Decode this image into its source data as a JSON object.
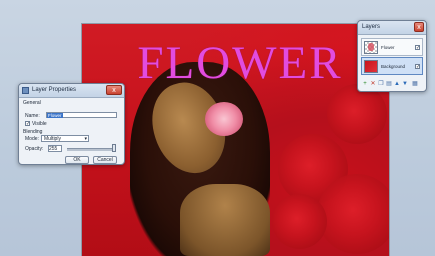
{
  "canvas": {
    "title": "FLOWER"
  },
  "layer_properties": {
    "window_title": "Layer Properties",
    "close_label": "x",
    "general_label": "General",
    "name_label": "Name:",
    "name_value": "Flower",
    "visible_label": "Visible",
    "visible_checked": true,
    "blending_label": "Blending",
    "mode_label": "Mode:",
    "mode_value": "Multiply",
    "opacity_label": "Opacity:",
    "opacity_value": "255",
    "ok_label": "OK",
    "cancel_label": "Cancel"
  },
  "layers_panel": {
    "window_title": "Layers",
    "close_label": "x",
    "layers": [
      {
        "name": "Flower",
        "visible": true,
        "selected": false
      },
      {
        "name": "Background",
        "visible": true,
        "selected": true
      }
    ],
    "tools": [
      "add-layer-icon",
      "delete-layer-icon",
      "duplicate-layer-icon",
      "merge-layer-icon",
      "move-up-icon",
      "move-down-icon",
      "properties-icon"
    ]
  },
  "colors": {
    "accent": "#3a74c9",
    "title_text": "#e24cdf",
    "canvas_red": "#c4111b"
  }
}
